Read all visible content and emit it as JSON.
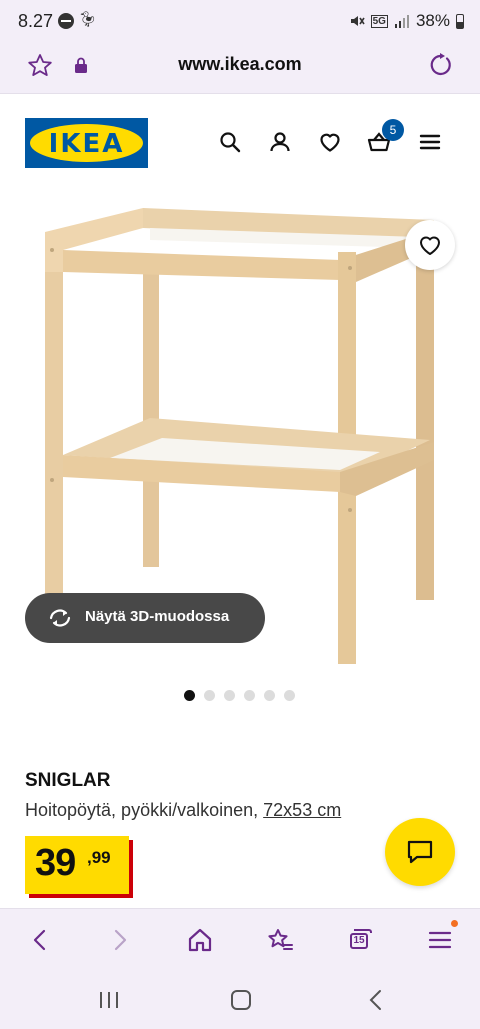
{
  "status_bar": {
    "time": "8.27",
    "battery": "38%",
    "network": "5G",
    "icons": [
      "do-not-disturb-icon",
      "duck-icon",
      "mute-icon",
      "5g-icon",
      "signal-icon",
      "battery-icon"
    ]
  },
  "browser": {
    "url": "www.ikea.com",
    "toolbar": {
      "tabs_count": "15",
      "icons": [
        "back-icon",
        "forward-icon",
        "home-icon",
        "bookmarks-icon",
        "tabs-icon",
        "menu-icon"
      ]
    }
  },
  "header": {
    "logo_text": "IKEA",
    "basket_count": "5",
    "icons": [
      "search-icon",
      "user-icon",
      "heart-icon",
      "basket-icon",
      "hamburger-menu-icon"
    ]
  },
  "gallery": {
    "view3d_label": "Näytä 3D-muodossa",
    "image_count": 6,
    "active_index": 0
  },
  "product": {
    "name": "SNIGLAR",
    "description": "Hoitopöytä, pyökki/valkoinen,",
    "size": "72x53 cm",
    "price_integer": "39",
    "price_decimal": ",99"
  },
  "colors": {
    "ikea_blue": "#0058a3",
    "ikea_yellow": "#ffdb00",
    "price_shadow_red": "#cc0008",
    "browser_accent": "#6a2a8a"
  }
}
